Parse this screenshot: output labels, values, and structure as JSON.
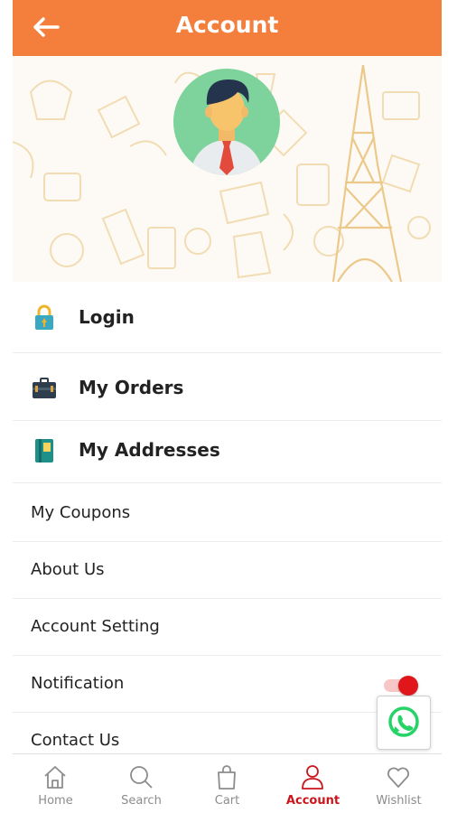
{
  "header": {
    "title": "Account",
    "back_icon": "arrow-left-icon"
  },
  "colors": {
    "header": "#f47f3c",
    "accent": "#c9161d",
    "toggle_on": "#e0161b",
    "whatsapp": "#25d366"
  },
  "profile": {
    "avatar_icon": "user-avatar-icon"
  },
  "menu": {
    "login": "Login",
    "my_orders": "My Orders",
    "my_addresses": "My Addresses",
    "my_coupons": "My Coupons",
    "about_us": "About Us",
    "account_setting": "Account Setting",
    "notification": "Notification",
    "contact_us": "Contact Us"
  },
  "notification_toggle": {
    "on": true
  },
  "bottom_nav": {
    "home": "Home",
    "search": "Search",
    "cart": "Cart",
    "account": "Account",
    "wishlist": "Wishlist",
    "active": "Account"
  }
}
